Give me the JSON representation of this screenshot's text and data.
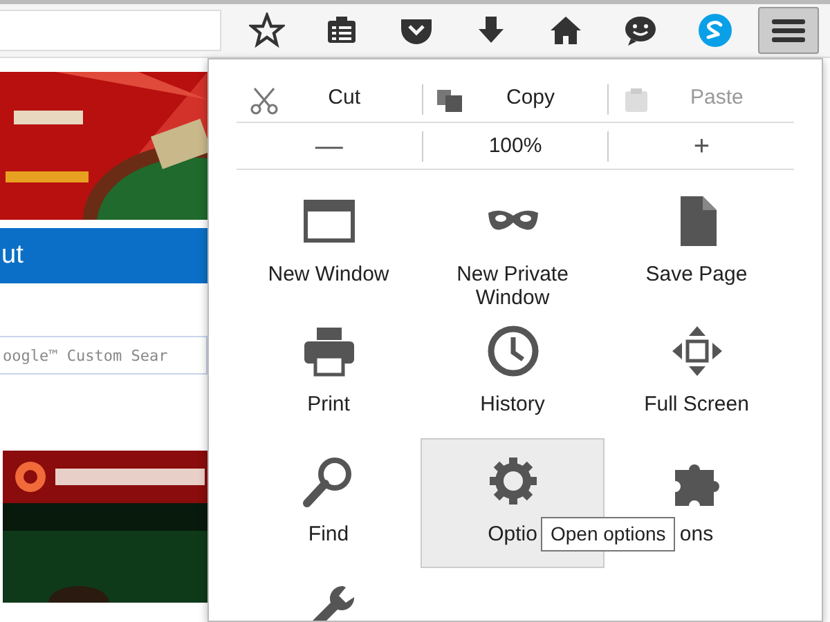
{
  "toolbar": {
    "menu_button": {
      "selected": true
    }
  },
  "page": {
    "nav_bar": {
      "label": "ut"
    },
    "search": {
      "placeholder": "oogle™ Custom Sear"
    }
  },
  "menu": {
    "edit_row": [
      {
        "kind": "cut",
        "label": "Cut",
        "disabled": false
      },
      {
        "kind": "copy",
        "label": "Copy",
        "disabled": false
      },
      {
        "kind": "paste",
        "label": "Paste",
        "disabled": true
      }
    ],
    "zoom_row": {
      "out": "—",
      "level": "100%",
      "in": "+"
    },
    "items": [
      {
        "kind": "window",
        "label": "New Window",
        "selected": false
      },
      {
        "kind": "private",
        "label": "New Private Window",
        "selected": false
      },
      {
        "kind": "save",
        "label": "Save Page",
        "selected": false
      },
      {
        "kind": "print",
        "label": "Print",
        "selected": false
      },
      {
        "kind": "history",
        "label": "History",
        "selected": false
      },
      {
        "kind": "fullscreen",
        "label": "Full Screen",
        "selected": false
      },
      {
        "kind": "find",
        "label": "Find",
        "selected": false
      },
      {
        "kind": "options",
        "label": "Optio",
        "selected": true
      },
      {
        "kind": "addons",
        "label": "ons",
        "selected": false
      },
      {
        "kind": "customize",
        "selected": false
      }
    ],
    "tooltip": "Open options"
  }
}
